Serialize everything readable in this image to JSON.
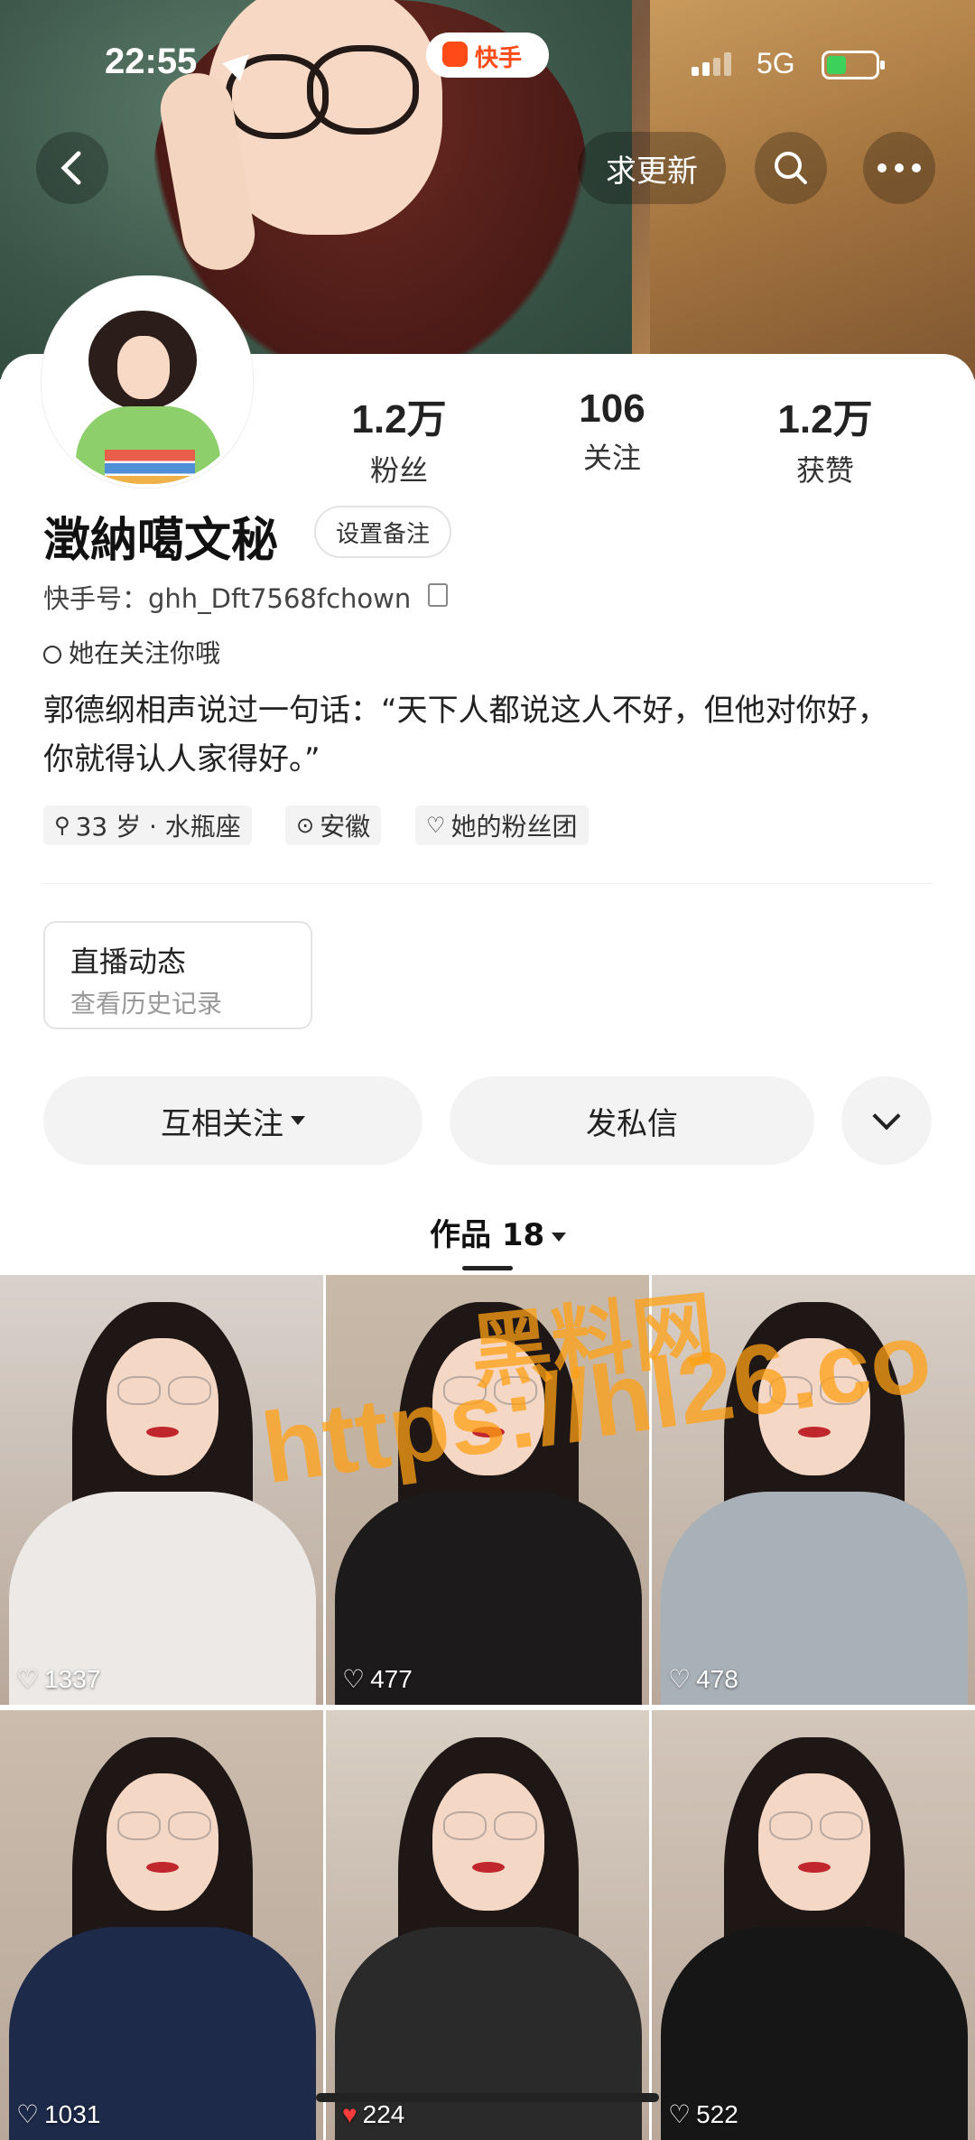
{
  "status_bar": {
    "time": "22:55",
    "app_badge": "快手",
    "network": "5G",
    "battery_level": 0.4
  },
  "header": {
    "update_button": "求更新"
  },
  "profile": {
    "name": "澂納噶文秘",
    "remark_button": "设置备注",
    "ks_id": "快手号：ghh_Dft7568fchown",
    "follow_hint": "她在关注你哦",
    "bio": "郭德纲相声说过一句话：“天下人都说这人不好，但他对你好，你就得认人家得好。”",
    "stats": [
      {
        "value": "1.2万",
        "label": "粉丝"
      },
      {
        "value": "106",
        "label": "关注"
      },
      {
        "value": "1.2万",
        "label": "获赞"
      }
    ],
    "tags": [
      {
        "icon": "search-icon",
        "text": "33 岁 · 水瓶座"
      },
      {
        "icon": "location-icon",
        "text": "安徽"
      },
      {
        "icon": "fan-group-icon",
        "text": "她的粉丝团"
      }
    ]
  },
  "live": {
    "title": "直播动态",
    "subtitle": "查看历史记录"
  },
  "actions": {
    "mutual_follow": "互相关注",
    "message": "发私信"
  },
  "works": {
    "tab_label": "作品 18",
    "items": [
      {
        "likes": "1337",
        "liked": false,
        "bg": "#d9d2cc",
        "cloth": "#ece9e6"
      },
      {
        "likes": "477",
        "liked": false,
        "bg": "#c8b9a8",
        "cloth": "#1c1a1a"
      },
      {
        "likes": "478",
        "liked": false,
        "bg": "#d8cfc7",
        "cloth": "#a9b1b8"
      },
      {
        "likes": "1031",
        "liked": false,
        "bg": "#cbbcae",
        "cloth": "#1d2a4a"
      },
      {
        "likes": "224",
        "liked": true,
        "bg": "#d9cfc4",
        "cloth": "#2b2a2b"
      },
      {
        "likes": "522",
        "liked": false,
        "bg": "#d3c6ba",
        "cloth": "#161616"
      }
    ]
  },
  "watermark": {
    "line1": "黑料网",
    "line2": "https://hl26.co"
  },
  "colors": {
    "accent": "#ff4b18",
    "like_red": "#ff3b3b"
  }
}
